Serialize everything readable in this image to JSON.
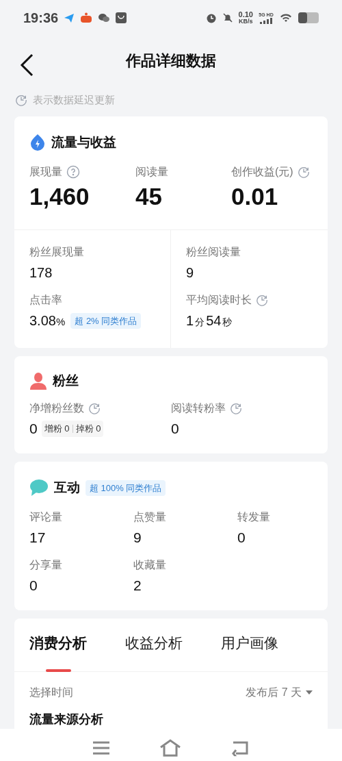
{
  "status_bar": {
    "time": "19:36",
    "net_speed_value": "0.10",
    "net_speed_unit": "KB/s",
    "network": "5G HD"
  },
  "header": {
    "title": "作品详细数据"
  },
  "delay_note": "表示数据延迟更新",
  "traffic": {
    "title": "流量与收益",
    "top_metrics": [
      {
        "label": "展现量",
        "value": "1,460",
        "has_help": true,
        "delayed": false
      },
      {
        "label": "阅读量",
        "value": "45",
        "has_help": false,
        "delayed": false
      },
      {
        "label": "创作收益(元)",
        "value": "0.01",
        "has_help": false,
        "delayed": true
      }
    ],
    "sub_metrics": [
      {
        "label": "粉丝展现量",
        "value": "178",
        "delayed": false
      },
      {
        "label": "粉丝阅读量",
        "value": "9",
        "delayed": false
      },
      {
        "label": "点击率",
        "value": "3.08",
        "unit": "%",
        "badge": "超 2% 同类作品",
        "delayed": false
      },
      {
        "label": "平均阅读时长",
        "parts": [
          "1",
          "分",
          "54",
          "秒"
        ],
        "delayed": true
      }
    ]
  },
  "fans": {
    "title": "粉丝",
    "metrics": [
      {
        "label": "净增粉丝数",
        "value": "0",
        "delayed": true,
        "detail": [
          {
            "label": "增粉",
            "value": "0"
          },
          {
            "label": "掉粉",
            "value": "0"
          }
        ]
      },
      {
        "label": "阅读转粉率",
        "value": "0",
        "delayed": true
      }
    ]
  },
  "interaction": {
    "title": "互动",
    "badge": "超 100% 同类作品",
    "metrics": [
      {
        "label": "评论量",
        "value": "17"
      },
      {
        "label": "点赞量",
        "value": "9"
      },
      {
        "label": "转发量",
        "value": "0"
      },
      {
        "label": "分享量",
        "value": "0"
      },
      {
        "label": "收藏量",
        "value": "2"
      }
    ]
  },
  "analysis": {
    "tabs": [
      {
        "label": "消费分析",
        "selected": true
      },
      {
        "label": "收益分析",
        "selected": false
      },
      {
        "label": "用户画像",
        "selected": false
      }
    ],
    "time_label": "选择时间",
    "time_value": "发布后 7 天",
    "section_title": "流量来源分析"
  }
}
